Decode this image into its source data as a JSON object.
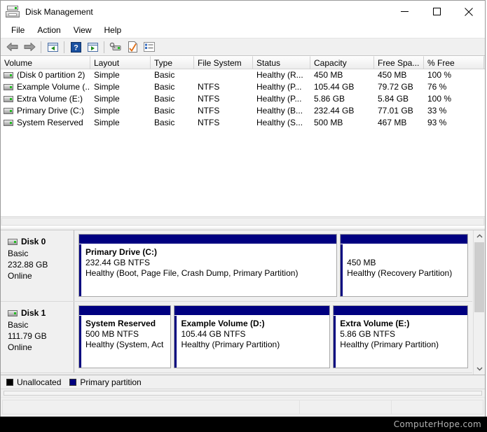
{
  "window": {
    "title": "Disk Management",
    "icon": "disk-drive-icon",
    "controls": {
      "minimize": "—",
      "maximize": "☐",
      "close": "✕"
    }
  },
  "menubar": {
    "items": [
      {
        "label": "File"
      },
      {
        "label": "Action"
      },
      {
        "label": "View"
      },
      {
        "label": "Help"
      }
    ]
  },
  "toolbar": {
    "buttons": [
      {
        "name": "back-icon"
      },
      {
        "name": "forward-icon"
      },
      {
        "name": "up-one-level-icon"
      },
      {
        "name": "help-icon"
      },
      {
        "name": "show-action-pane-icon"
      },
      {
        "name": "rescan-disks-icon"
      },
      {
        "name": "properties-icon"
      },
      {
        "name": "list-view-icon"
      }
    ]
  },
  "volume_list": {
    "columns": [
      {
        "label": "Volume",
        "width": 128
      },
      {
        "label": "Layout",
        "width": 86
      },
      {
        "label": "Type",
        "width": 62
      },
      {
        "label": "File System",
        "width": 84
      },
      {
        "label": "Status",
        "width": 82
      },
      {
        "label": "Capacity",
        "width": 91
      },
      {
        "label": "Free Spa...",
        "width": 71
      },
      {
        "label": "% Free",
        "width": 86
      }
    ],
    "rows": [
      {
        "icon": "volume-icon",
        "volume": "(Disk 0 partition 2)",
        "layout": "Simple",
        "type": "Basic",
        "file_system": "",
        "status": "Healthy (R...",
        "capacity": "450 MB",
        "free_space": "450 MB",
        "percent_free": "100 %"
      },
      {
        "icon": "volume-icon",
        "volume": "Example Volume (...",
        "layout": "Simple",
        "type": "Basic",
        "file_system": "NTFS",
        "status": "Healthy (P...",
        "capacity": "105.44 GB",
        "free_space": "79.72 GB",
        "percent_free": "76 %"
      },
      {
        "icon": "volume-icon",
        "volume": "Extra Volume (E:)",
        "layout": "Simple",
        "type": "Basic",
        "file_system": "NTFS",
        "status": "Healthy (P...",
        "capacity": "5.86 GB",
        "free_space": "5.84 GB",
        "percent_free": "100 %"
      },
      {
        "icon": "volume-icon",
        "volume": "Primary Drive (C:)",
        "layout": "Simple",
        "type": "Basic",
        "file_system": "NTFS",
        "status": "Healthy (B...",
        "capacity": "232.44 GB",
        "free_space": "77.01 GB",
        "percent_free": "33 %"
      },
      {
        "icon": "volume-icon",
        "volume": "System Reserved",
        "layout": "Simple",
        "type": "Basic",
        "file_system": "NTFS",
        "status": "Healthy (S...",
        "capacity": "500 MB",
        "free_space": "467 MB",
        "percent_free": "93 %"
      }
    ]
  },
  "graphical_view": {
    "disks": [
      {
        "name": "Disk 0",
        "icon": "disk-icon",
        "type": "Basic",
        "size": "232.88 GB",
        "status": "Online",
        "partitions": [
          {
            "name": "Primary Drive  (C:)",
            "size_fs": "232.44 GB NTFS",
            "status": "Healthy (Boot, Page File, Crash Dump, Primary Partition)",
            "bar_color": "#000080",
            "flex": 67
          },
          {
            "name": "",
            "size_fs": "450 MB",
            "status": "Healthy (Recovery Partition)",
            "bar_color": "#000080",
            "flex": 33
          }
        ]
      },
      {
        "name": "Disk 1",
        "icon": "disk-icon",
        "type": "Basic",
        "size": "111.79 GB",
        "status": "Online",
        "partitions": [
          {
            "name": "System Reserved",
            "size_fs": "500 MB NTFS",
            "status": "Healthy (System, Act",
            "bar_color": "#000080",
            "flex": 26
          },
          {
            "name": "Example Volume  (D:)",
            "size_fs": "105.44 GB NTFS",
            "status": "Healthy (Primary Partition)",
            "bar_color": "#000080",
            "flex": 44
          },
          {
            "name": "Extra Volume  (E:)",
            "size_fs": "5.86 GB NTFS",
            "status": "Healthy (Primary Partition)",
            "bar_color": "#000080",
            "flex": 38
          }
        ]
      }
    ]
  },
  "legend": {
    "items": [
      {
        "label": "Unallocated",
        "color": "#000000"
      },
      {
        "label": "Primary partition",
        "color": "#000080"
      }
    ]
  },
  "statusbar": {
    "pane1": "",
    "pane2": "",
    "pane3": ""
  },
  "watermark": {
    "text": "ComputerHope.com"
  }
}
